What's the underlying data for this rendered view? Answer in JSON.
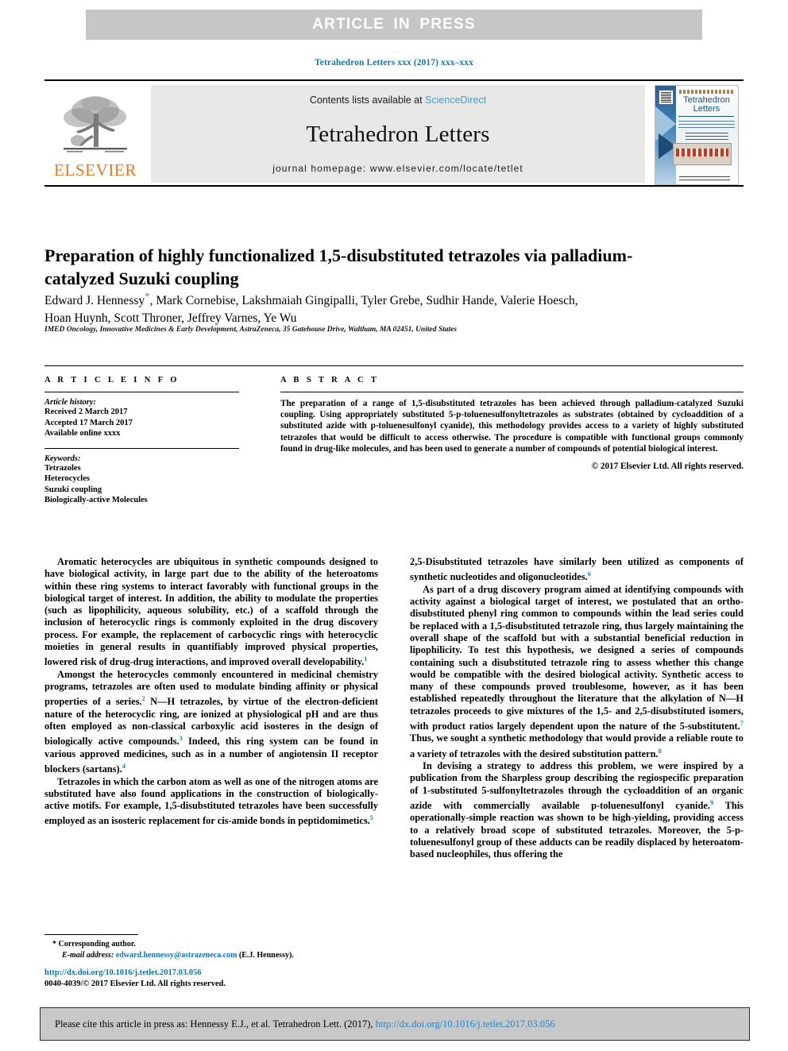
{
  "banner": {
    "press_label": "ARTICLE IN PRESS"
  },
  "journal_ref": "Tetrahedron Letters xxx (2017) xxx–xxx",
  "masthead": {
    "publisher_name": "ELSEVIER",
    "publisher_logo_icon": "elsevier-tree-icon",
    "contents_prefix": "Contents lists available at ",
    "contents_link": "ScienceDirect",
    "journal_name": "Tetrahedron Letters",
    "homepage_line": "journal homepage: www.elsevier.com/locate/tetlet",
    "cover": {
      "icon": "journal-cover-thumbnail",
      "title_line1": "Tetrahedron",
      "title_line2": "Letters"
    }
  },
  "article": {
    "title": "Preparation of highly functionalized 1,5-disubstituted tetrazoles via palladium-catalyzed Suzuki coupling",
    "authors_line1_pre": "Edward J. Hennessy",
    "authors_star": "*",
    "authors_line1_post": ", Mark Cornebise, Lakshmaiah Gingipalli, Tyler Grebe, Sudhir Hande, Valerie Hoesch,",
    "authors_line2": "Hoan Huynh, Scott Throner, Jeffrey Varnes, Ye Wu",
    "affiliation": "IMED Oncology, Innovative Medicines & Early Development, AstraZeneca, 35 Gatehouse Drive, Waltham, MA 02451, United States"
  },
  "article_info": {
    "heading": "A R T I C L E   I N F O",
    "history_label": "Article history:",
    "history_lines": [
      "Received 2 March 2017",
      "Accepted 17 March 2017",
      "Available online xxxx"
    ],
    "keywords_label": "Keywords:",
    "keywords": [
      "Tetrazoles",
      "Heterocycles",
      "Suzuki coupling",
      "Biologically-active Molecules"
    ]
  },
  "abstract": {
    "heading": "A B S T R A C T",
    "text": "The preparation of a range of 1,5-disubstituted tetrazoles has been achieved through palladium-catalyzed Suzuki coupling. Using appropriately substituted 5-p-toluenesulfonyltetrazoles as substrates (obtained by cycloaddition of a substituted azide with p-toluenesulfonyl cyanide), this methodology provides access to a variety of highly substituted tetrazoles that would be difficult to access otherwise. The procedure is compatible with functional groups commonly found in drug-like molecules, and has been used to generate a number of compounds of potential biological interest.",
    "copyright": "© 2017 Elsevier Ltd. All rights reserved."
  },
  "body": {
    "left_column": [
      {
        "text": "Aromatic heterocycles are ubiquitous in synthetic compounds designed to have biological activity, in large part due to the ability of the heteroatoms within these ring systems to interact favorably with functional groups in the biological target of interest. In addition, the ability to modulate the properties (such as lipophilicity, aqueous solubility, etc.) of a scaffold through the inclusion of heterocyclic rings is commonly exploited in the drug discovery process. For example, the replacement of carbocyclic rings with heterocyclic moieties in general results in quantifiably improved physical properties, lowered risk of drug-drug interactions, and improved overall developability.",
        "ref": "1",
        "indent": true
      },
      {
        "text": "Amongst the heterocycles commonly encountered in medicinal chemistry programs, tetrazoles are often used to modulate binding affinity or physical properties of a series.",
        "ref": "2",
        "indent": true,
        "text2": " N—H tetrazoles, by virtue of the electron-deficient nature of the heterocyclic ring, are ionized at physiological pH and are thus often employed as non-classical carboxylic acid isosteres in the design of biologically active compounds.",
        "ref2": "3",
        "text3": " Indeed, this ring system can be found in various approved medicines, such as in a number of angiotensin II receptor blockers (sartans).",
        "ref3": "4"
      },
      {
        "text": "Tetrazoles in which the carbon atom as well as one of the nitrogen atoms are substituted have also found applications in the construction of biologically-active motifs. For example, 1,5-disubstituted tetrazoles have been successfully employed as an isosteric replacement for cis-amide bonds in peptidomimetics.",
        "ref": "5",
        "indent": true
      }
    ],
    "right_column": [
      {
        "text": "2,5-Disubstituted tetrazoles have similarly been utilized as components of synthetic nucleotides and oligonucleotides.",
        "ref": "6",
        "indent": false
      },
      {
        "text": "As part of a drug discovery program aimed at identifying compounds with activity against a biological target of interest, we postulated that an ortho-disubstituted phenyl ring common to compounds within the lead series could be replaced with a 1,5-disubstituted tetrazole ring, thus largely maintaining the overall shape of the scaffold but with a substantial beneficial reduction in lipophilicity. To test this hypothesis, we designed a series of compounds containing such a disubstituted tetrazole ring to assess whether this change would be compatible with the desired biological activity. Synthetic access to many of these compounds proved troublesome, however, as it has been established repeatedly throughout the literature that the alkylation of N—H tetrazoles proceeds to give mixtures of the 1,5- and 2,5-disubstituted isomers, with product ratios largely dependent upon the nature of the 5-substitutent.",
        "ref": "7",
        "indent": true,
        "text2": " Thus, we sought a synthetic methodology that would provide a reliable route to a variety of tetrazoles with the desired substitution pattern.",
        "ref2": "8"
      },
      {
        "text": "In devising a strategy to address this problem, we were inspired by a publication from the Sharpless group describing the regiospecific preparation of 1-substituted 5-sulfonyltetrazoles through the cycloaddition of an organic azide with commercially available p-toluenesulfonyl cyanide.",
        "ref": "9",
        "indent": true,
        "text2": " This operationally-simple reaction was shown to be high-yielding, providing access to a relatively broad scope of substituted tetrazoles. Moreover, the 5-p-toluenesulfonyl group of these adducts can be readily displaced by heteroatom-based nucleophiles, thus offering the"
      }
    ]
  },
  "footnote": {
    "corresponding_marker": "*",
    "corresponding_label": "Corresponding author.",
    "email_label": "E-mail address:",
    "email": "edward.hennessy@astrazeneca.com",
    "email_owner": "(E.J. Hennessy)."
  },
  "doi_block": {
    "doi_url": "http://dx.doi.org/10.1016/j.tetlet.2017.03.056",
    "issn_line": "0040-4039/© 2017 Elsevier Ltd. All rights reserved."
  },
  "cite_banner": {
    "prefix": "Please cite this article in press as: Hennessy E.J., et al. Tetrahedron Lett. (2017), ",
    "doi": "http://dx.doi.org/10.1016/j.tetlet.2017.03.056"
  },
  "colors": {
    "banner_gray": "#c6c6c6",
    "journal_blue": "#0b7aa5",
    "link_blue": "#1272a8",
    "sciencedirect_blue": "#3b9ed4",
    "elsevier_orange": "#e87722",
    "ref_blue": "#1f7fb5",
    "cite_banner_gray": "#c8c8c8"
  }
}
